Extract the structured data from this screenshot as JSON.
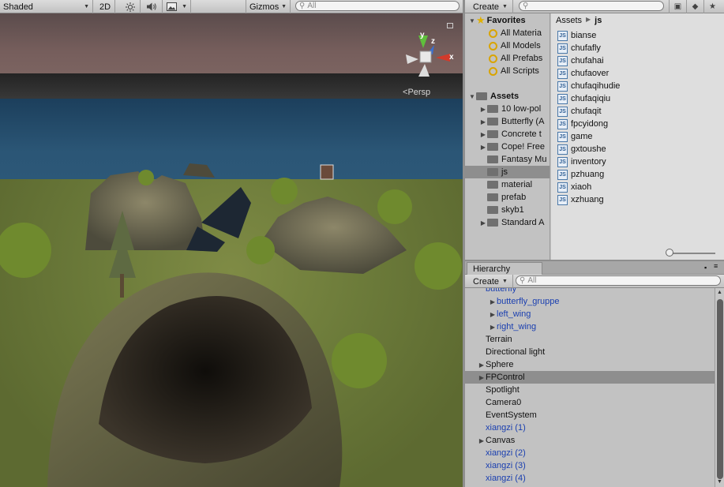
{
  "scene": {
    "shading_mode": "Shaded",
    "mode_2d": "2D",
    "gizmos_label": "Gizmos",
    "search_placeholder": "All",
    "camera_label": "Persp",
    "axis_y": "y",
    "axis_z": "z",
    "axis_x": "x"
  },
  "project": {
    "create_label": "Create",
    "search_placeholder": "",
    "favorites": {
      "title": "Favorites",
      "items": [
        {
          "label": "All Materia"
        },
        {
          "label": "All Models"
        },
        {
          "label": "All Prefabs"
        },
        {
          "label": "All Scripts"
        }
      ]
    },
    "assets": {
      "title": "Assets",
      "folders": [
        {
          "label": "10 low-pol",
          "expandable": true
        },
        {
          "label": "Butterfly (A",
          "expandable": true
        },
        {
          "label": "Concrete t",
          "expandable": true
        },
        {
          "label": "Cope! Free",
          "expandable": true
        },
        {
          "label": "Fantasy Mu",
          "expandable": false
        },
        {
          "label": "js",
          "expandable": false,
          "selected": true
        },
        {
          "label": "material",
          "expandable": false
        },
        {
          "label": "prefab",
          "expandable": false
        },
        {
          "label": "skyb1",
          "expandable": false
        },
        {
          "label": "Standard A",
          "expandable": true
        }
      ]
    },
    "breadcrumb": [
      "Assets",
      "js"
    ],
    "files": [
      "bianse",
      "chufafly",
      "chufahai",
      "chufaover",
      "chufaqihudie",
      "chufaqiqiu",
      "chufaqit",
      "fpcyidong",
      "game",
      "gxtoushe",
      "inventory",
      "pzhuang",
      "xiaoh",
      "xzhuang"
    ],
    "file_icon_label": "JS"
  },
  "hierarchy": {
    "tab_label": "Hierarchy",
    "create_label": "Create",
    "search_placeholder": "All",
    "rows": [
      {
        "label": "butterfly",
        "indent": 1,
        "arrow": false,
        "prefab": true,
        "selected": false
      },
      {
        "label": "butterfly_gruppe",
        "indent": 2,
        "arrow": true,
        "prefab": true,
        "selected": false
      },
      {
        "label": "left_wing",
        "indent": 2,
        "arrow": true,
        "prefab": true,
        "selected": false
      },
      {
        "label": "right_wing",
        "indent": 2,
        "arrow": true,
        "prefab": true,
        "selected": false
      },
      {
        "label": "Terrain",
        "indent": 1,
        "arrow": false,
        "prefab": false,
        "selected": false
      },
      {
        "label": "Directional light",
        "indent": 1,
        "arrow": false,
        "prefab": false,
        "selected": false
      },
      {
        "label": "Sphere",
        "indent": 1,
        "arrow": true,
        "prefab": false,
        "selected": false
      },
      {
        "label": "FPControl",
        "indent": 1,
        "arrow": true,
        "prefab": false,
        "selected": true
      },
      {
        "label": "Spotlight",
        "indent": 1,
        "arrow": false,
        "prefab": false,
        "selected": false
      },
      {
        "label": "Camera0",
        "indent": 1,
        "arrow": false,
        "prefab": false,
        "selected": false
      },
      {
        "label": "EventSystem",
        "indent": 1,
        "arrow": false,
        "prefab": false,
        "selected": false
      },
      {
        "label": "xiangzi (1)",
        "indent": 1,
        "arrow": false,
        "prefab": true,
        "selected": false
      },
      {
        "label": "Canvas",
        "indent": 1,
        "arrow": true,
        "prefab": false,
        "selected": false
      },
      {
        "label": "xiangzi (2)",
        "indent": 1,
        "arrow": false,
        "prefab": true,
        "selected": false
      },
      {
        "label": "xiangzi (3)",
        "indent": 1,
        "arrow": false,
        "prefab": true,
        "selected": false
      },
      {
        "label": "xiangzi (4)",
        "indent": 1,
        "arrow": false,
        "prefab": true,
        "selected": false
      }
    ]
  },
  "colors": {
    "prefab_text": "#1a3fb0",
    "selection": "#8e8e8e",
    "panel_bg": "#c2c2c2"
  }
}
